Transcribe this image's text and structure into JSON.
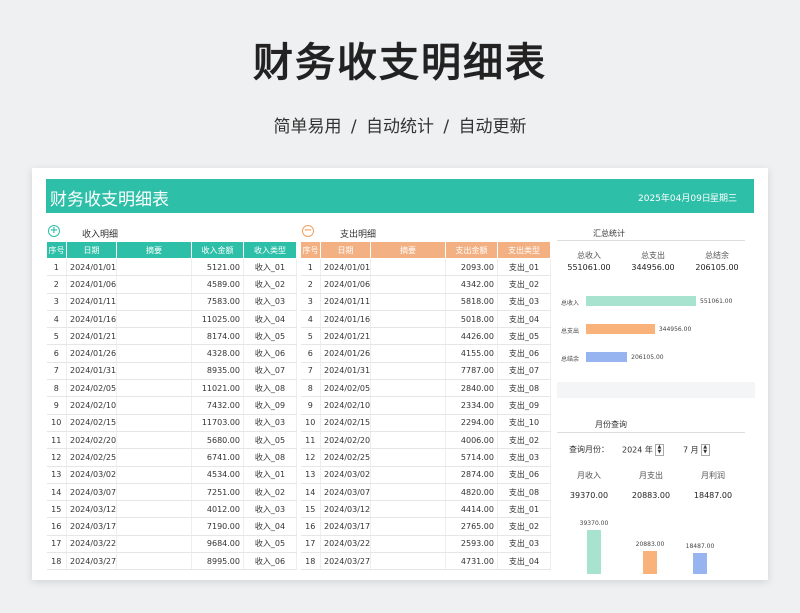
{
  "hero": {
    "title": "财务收支明细表",
    "subtitle": "简单易用  /  自动统计  /  自动更新"
  },
  "banner": {
    "title": "财务收支明细表",
    "date": "2025年04月09日",
    "weekday": "星期三"
  },
  "income": {
    "section_label": "收入明细",
    "headers": [
      "序号",
      "日期",
      "摘要",
      "收入金额",
      "收入类型"
    ],
    "rows": [
      [
        "1",
        "2024/01/01",
        "",
        "5121.00",
        "收入_01"
      ],
      [
        "2",
        "2024/01/06",
        "",
        "4589.00",
        "收入_02"
      ],
      [
        "3",
        "2024/01/11",
        "",
        "7583.00",
        "收入_03"
      ],
      [
        "4",
        "2024/01/16",
        "",
        "11025.00",
        "收入_04"
      ],
      [
        "5",
        "2024/01/21",
        "",
        "8174.00",
        "收入_05"
      ],
      [
        "6",
        "2024/01/26",
        "",
        "4328.00",
        "收入_06"
      ],
      [
        "7",
        "2024/01/31",
        "",
        "8935.00",
        "收入_07"
      ],
      [
        "8",
        "2024/02/05",
        "",
        "11021.00",
        "收入_08"
      ],
      [
        "9",
        "2024/02/10",
        "",
        "7432.00",
        "收入_09"
      ],
      [
        "10",
        "2024/02/15",
        "",
        "11703.00",
        "收入_03"
      ],
      [
        "11",
        "2024/02/20",
        "",
        "5680.00",
        "收入_05"
      ],
      [
        "12",
        "2024/02/25",
        "",
        "6741.00",
        "收入_08"
      ],
      [
        "13",
        "2024/03/02",
        "",
        "4534.00",
        "收入_01"
      ],
      [
        "14",
        "2024/03/07",
        "",
        "7251.00",
        "收入_02"
      ],
      [
        "15",
        "2024/03/12",
        "",
        "4012.00",
        "收入_03"
      ],
      [
        "16",
        "2024/03/17",
        "",
        "7190.00",
        "收入_04"
      ],
      [
        "17",
        "2024/03/22",
        "",
        "9684.00",
        "收入_05"
      ],
      [
        "18",
        "2024/03/27",
        "",
        "8995.00",
        "收入_06"
      ]
    ]
  },
  "expense": {
    "section_label": "支出明细",
    "headers": [
      "序号",
      "日期",
      "摘要",
      "支出金额",
      "支出类型"
    ],
    "rows": [
      [
        "1",
        "2024/01/01",
        "",
        "2093.00",
        "支出_01"
      ],
      [
        "2",
        "2024/01/06",
        "",
        "4342.00",
        "支出_02"
      ],
      [
        "3",
        "2024/01/11",
        "",
        "5818.00",
        "支出_03"
      ],
      [
        "4",
        "2024/01/16",
        "",
        "5018.00",
        "支出_04"
      ],
      [
        "5",
        "2024/01/21",
        "",
        "4426.00",
        "支出_05"
      ],
      [
        "6",
        "2024/01/26",
        "",
        "4155.00",
        "支出_06"
      ],
      [
        "7",
        "2024/01/31",
        "",
        "7787.00",
        "支出_07"
      ],
      [
        "8",
        "2024/02/05",
        "",
        "2840.00",
        "支出_08"
      ],
      [
        "9",
        "2024/02/10",
        "",
        "2334.00",
        "支出_09"
      ],
      [
        "10",
        "2024/02/15",
        "",
        "2294.00",
        "支出_10"
      ],
      [
        "11",
        "2024/02/20",
        "",
        "4006.00",
        "支出_02"
      ],
      [
        "12",
        "2024/02/25",
        "",
        "5714.00",
        "支出_03"
      ],
      [
        "13",
        "2024/03/02",
        "",
        "2874.00",
        "支出_06"
      ],
      [
        "14",
        "2024/03/07",
        "",
        "4820.00",
        "支出_08"
      ],
      [
        "15",
        "2024/03/12",
        "",
        "4414.00",
        "支出_01"
      ],
      [
        "16",
        "2024/03/17",
        "",
        "2765.00",
        "支出_02"
      ],
      [
        "17",
        "2024/03/22",
        "",
        "2593.00",
        "支出_03"
      ],
      [
        "18",
        "2024/03/27",
        "",
        "4731.00",
        "支出_04"
      ]
    ]
  },
  "summary": {
    "title": "汇总统计",
    "labels": [
      "总收入",
      "总支出",
      "总结余"
    ],
    "values": [
      "551061.00",
      "344956.00",
      "206105.00"
    ]
  },
  "monthly": {
    "title": "月份查询",
    "query_label": "查询月份：",
    "year": "2024",
    "year_unit": "年",
    "month": "7",
    "month_unit": "月",
    "labels": [
      "月收入",
      "月支出",
      "月利润"
    ],
    "values": [
      "39370.00",
      "20883.00",
      "18487.00"
    ]
  },
  "chart_data": [
    {
      "type": "bar",
      "orientation": "horizontal",
      "categories": [
        "总收入",
        "总支出",
        "总结余"
      ],
      "values": [
        551061.0,
        344956.0,
        206105.0
      ],
      "value_labels": [
        "551061.00",
        "344956.00",
        "206105.00"
      ],
      "colors": [
        "#a8e3cf",
        "#f9b27a",
        "#98b4f0"
      ]
    },
    {
      "type": "bar",
      "categories": [
        "月收入",
        "月支出",
        "月利润"
      ],
      "values": [
        39370.0,
        20883.0,
        18487.0
      ],
      "value_labels": [
        "39370.00",
        "20883.00",
        "18487.00"
      ],
      "colors": [
        "#a8e3cf",
        "#f9b27a",
        "#98b4f0"
      ]
    }
  ],
  "colors": {
    "teal": "#2ebfa8",
    "orange": "#f3b082"
  }
}
